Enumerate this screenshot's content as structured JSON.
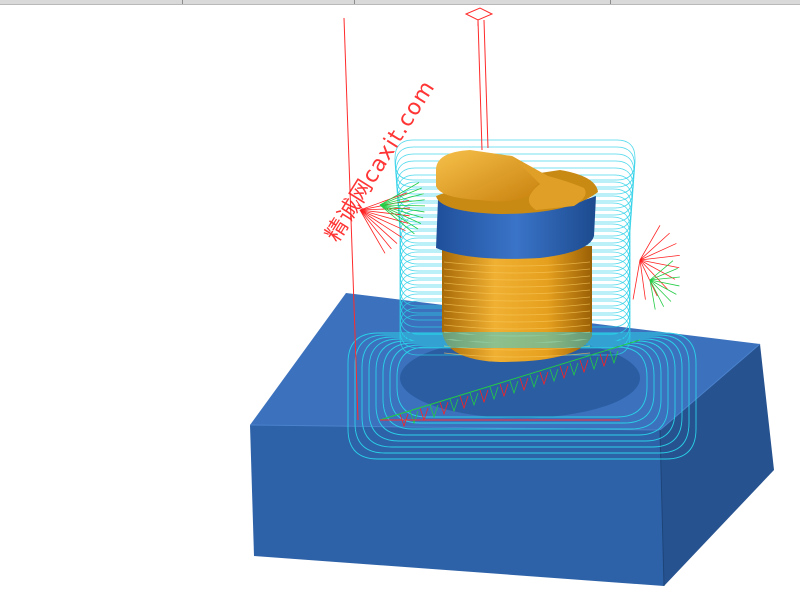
{
  "watermark": {
    "text": "精诚网caxit.com",
    "color": "#ff1f1f"
  },
  "colors": {
    "block_front": "#2f63a8",
    "block_top": "#3d74bf",
    "block_side": "#244f8a",
    "part_gold": "#e8a21c",
    "part_blue": "#2c62b4",
    "toolpath_cyan": "#2ad0e8",
    "toolpath_green": "#22cc44",
    "leadin_red": "#ff2020"
  },
  "icons": [
    "workplane-icon"
  ]
}
